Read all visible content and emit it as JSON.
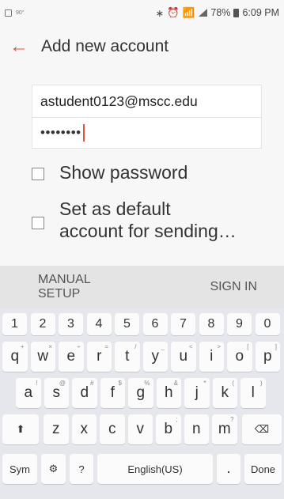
{
  "status_bar": {
    "temperature": "90°",
    "battery_percent": "78%",
    "time": "6:09 PM"
  },
  "app_bar": {
    "title": "Add new account"
  },
  "form": {
    "email_value": "astudent0123@mscc.edu",
    "password_masked": "••••••••",
    "show_password_label": "Show password",
    "default_account_label_line1": "Set as default",
    "default_account_label_line2": "account for sending…"
  },
  "actions": {
    "manual_setup_line1": "MANUAL",
    "manual_setup_line2": "SETUP",
    "sign_in": "SIGN IN"
  },
  "keyboard": {
    "numbers": [
      "1",
      "2",
      "3",
      "4",
      "5",
      "6",
      "7",
      "8",
      "9",
      "0"
    ],
    "row1": [
      "q",
      "w",
      "e",
      "r",
      "t",
      "y",
      "u",
      "i",
      "o",
      "p"
    ],
    "row1_hints": [
      "+",
      "×",
      "÷",
      "=",
      "/",
      "_",
      "<",
      ">",
      "[",
      "]"
    ],
    "row2": [
      "a",
      "s",
      "d",
      "f",
      "g",
      "h",
      "j",
      "k",
      "l"
    ],
    "row2_hints": [
      "!",
      "@",
      "#",
      "$",
      "%",
      "&",
      "*",
      "(",
      ")"
    ],
    "row3": [
      "z",
      "x",
      "c",
      "v",
      "b",
      "n",
      "m"
    ],
    "row3_hints": [
      "",
      "",
      "",
      "",
      ";",
      "",
      "?"
    ],
    "sym_label": "Sym",
    "question_label": "?",
    "space_label": "English(US)",
    "period_label": ".",
    "done_label": "Done"
  }
}
